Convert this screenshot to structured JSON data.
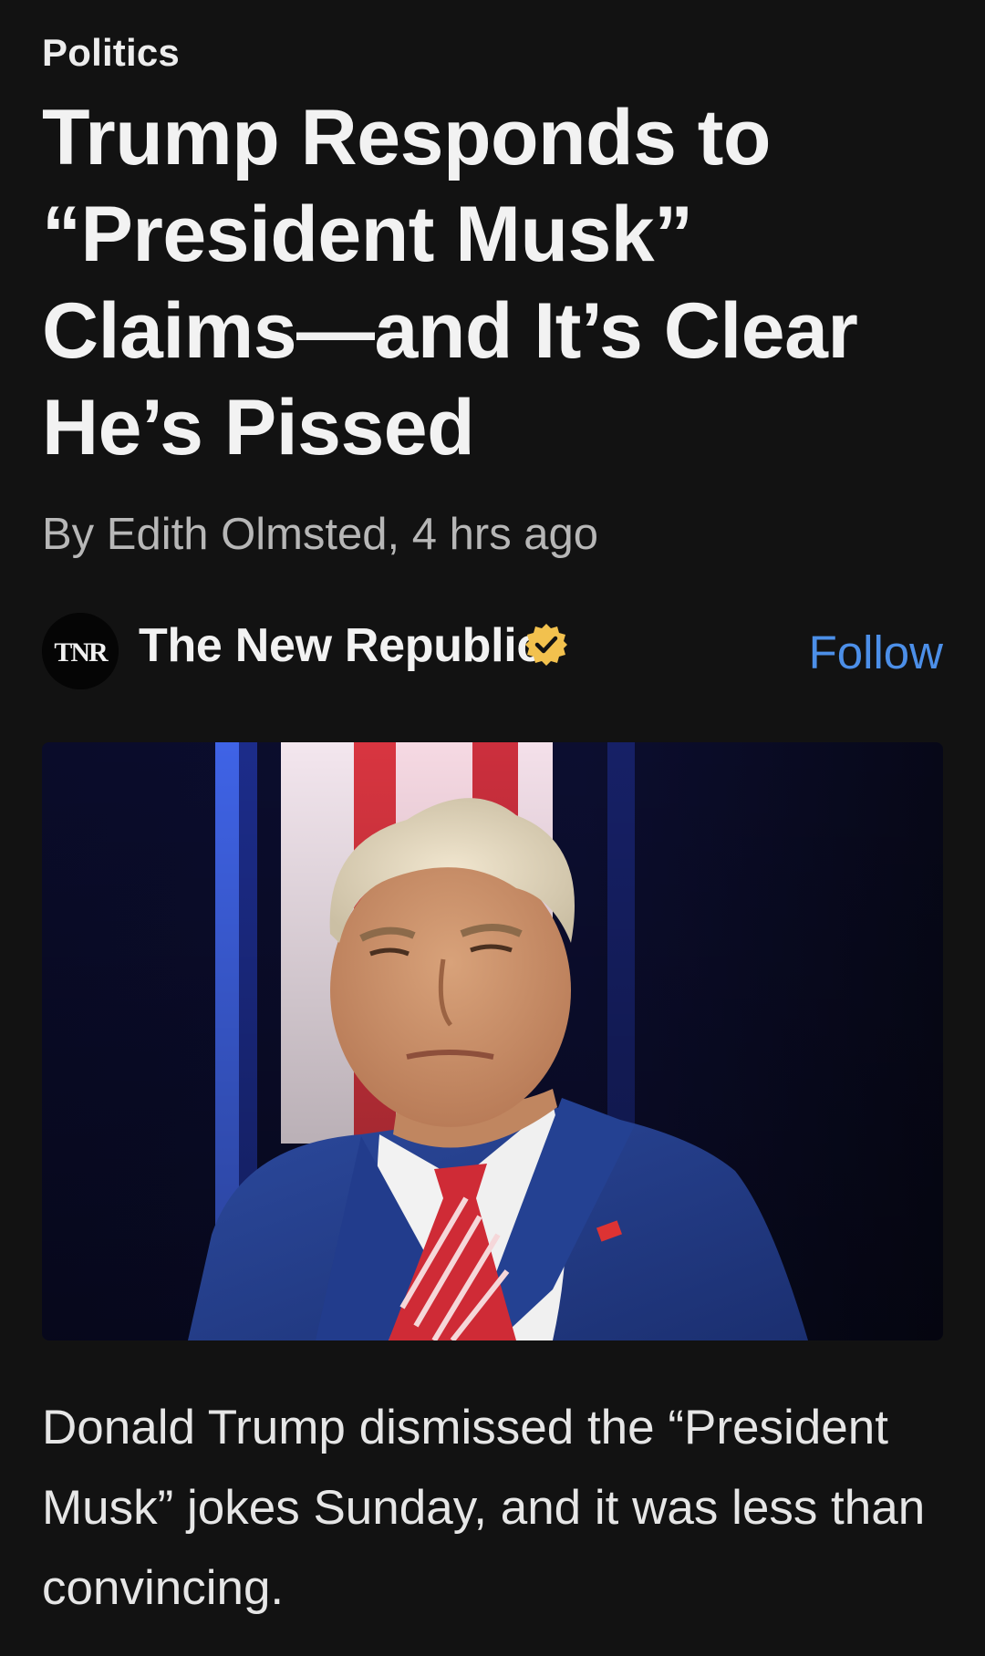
{
  "article": {
    "category": "Politics",
    "headline": "Trump Responds to “President Musk” Claims—and It’s Clear He’s Pissed",
    "byline": "By Edith Olmsted, 4 hrs ago",
    "summary": "Donald Trump dismissed the “President Musk” jokes Sunday, and it was less than convincing."
  },
  "source": {
    "name": "The New Republic",
    "logo_text": "TNR",
    "verified": true,
    "follow_label": "Follow"
  },
  "icons": {
    "verified": "verified-badge-icon"
  },
  "colors": {
    "background": "#121212",
    "accent": "#4c8fe8",
    "verified_badge": "#f2c14e"
  }
}
